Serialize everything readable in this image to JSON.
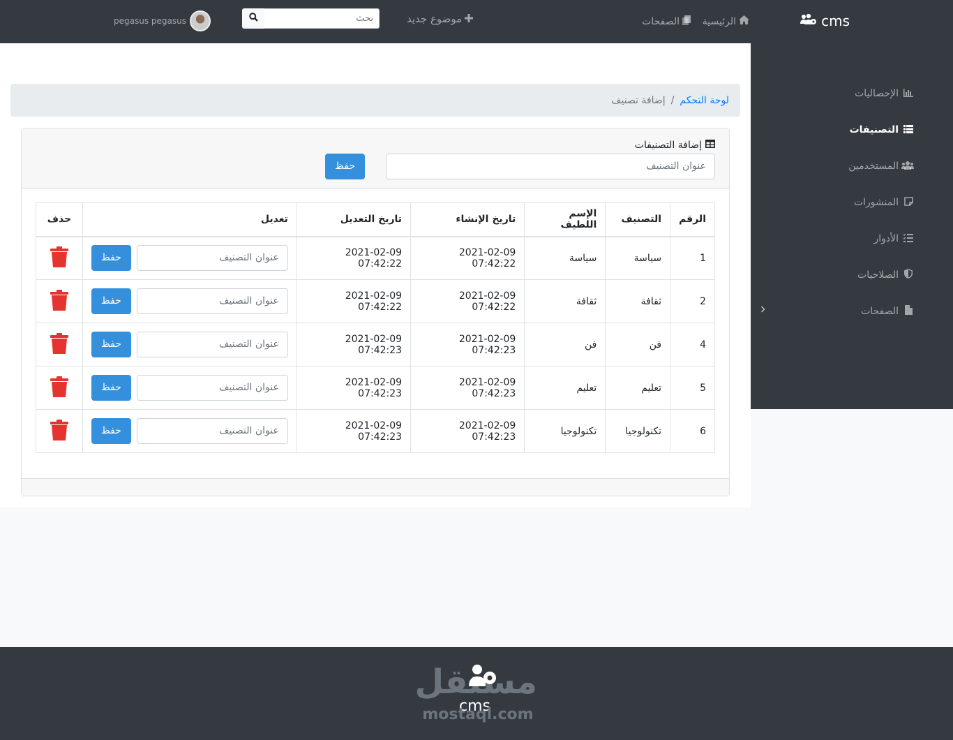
{
  "topbar": {
    "brand": "cms",
    "nav_home": "الرئيسية",
    "nav_pages": "الصفحات",
    "nav_new_topic": "موضوع جديد",
    "search_placeholder": "بحث",
    "user_name": "pegasus pegasus"
  },
  "sidebar": {
    "items": [
      {
        "label": "الإحصاليات",
        "icon": "chart-icon"
      },
      {
        "label": "التصنيفات",
        "icon": "list-icon"
      },
      {
        "label": "المستخدمين",
        "icon": "users-icon"
      },
      {
        "label": "المنشورات",
        "icon": "sticky-note-icon"
      },
      {
        "label": "الأدوار",
        "icon": "tasks-icon"
      },
      {
        "label": "الصلاحيات",
        "icon": "shield-icon"
      },
      {
        "label": "الصفحات",
        "icon": "file-icon"
      }
    ],
    "active_index": 1
  },
  "breadcrumb": {
    "home": "لوحة التحكم",
    "separator": "/",
    "current": "إضافة تصنيف"
  },
  "add_form": {
    "title": "إضافة التصنيفات",
    "input_placeholder": "عنوان التصنيف",
    "save_label": "حفظ"
  },
  "table": {
    "headers": {
      "num": "الرقم",
      "category": "التصنيف",
      "slug": "الإسم اللطيف",
      "created": "تاريخ الإنشاء",
      "updated": "تاريخ التعديل",
      "edit": "تعديل",
      "delete": "حذف"
    },
    "edit_placeholder": "عنوان التصنيف",
    "edit_save_label": "حفظ",
    "rows": [
      {
        "id": "1",
        "category": "سياسة",
        "slug": "سياسة",
        "created": "2021-02-09 07:42:22",
        "updated": "2021-02-09 07:42:22"
      },
      {
        "id": "2",
        "category": "ثقافة",
        "slug": "ثقافة",
        "created": "2021-02-09 07:42:22",
        "updated": "2021-02-09 07:42:22"
      },
      {
        "id": "4",
        "category": "فن",
        "slug": "فن",
        "created": "2021-02-09 07:42:23",
        "updated": "2021-02-09 07:42:23"
      },
      {
        "id": "5",
        "category": "تعليم",
        "slug": "تعليم",
        "created": "2021-02-09 07:42:23",
        "updated": "2021-02-09 07:42:23"
      },
      {
        "id": "6",
        "category": "تكنولوجيا",
        "slug": "تكنولوجيا",
        "created": "2021-02-09 07:42:23",
        "updated": "2021-02-09 07:42:23"
      }
    ]
  },
  "footer": {
    "logo_arabic": "مستقل",
    "logo_cms": "cms",
    "logo_site": "mostaql.com"
  },
  "colors": {
    "dark": "#343a40",
    "primary": "#3490dc",
    "danger": "#e3342f",
    "link": "#007bff"
  }
}
